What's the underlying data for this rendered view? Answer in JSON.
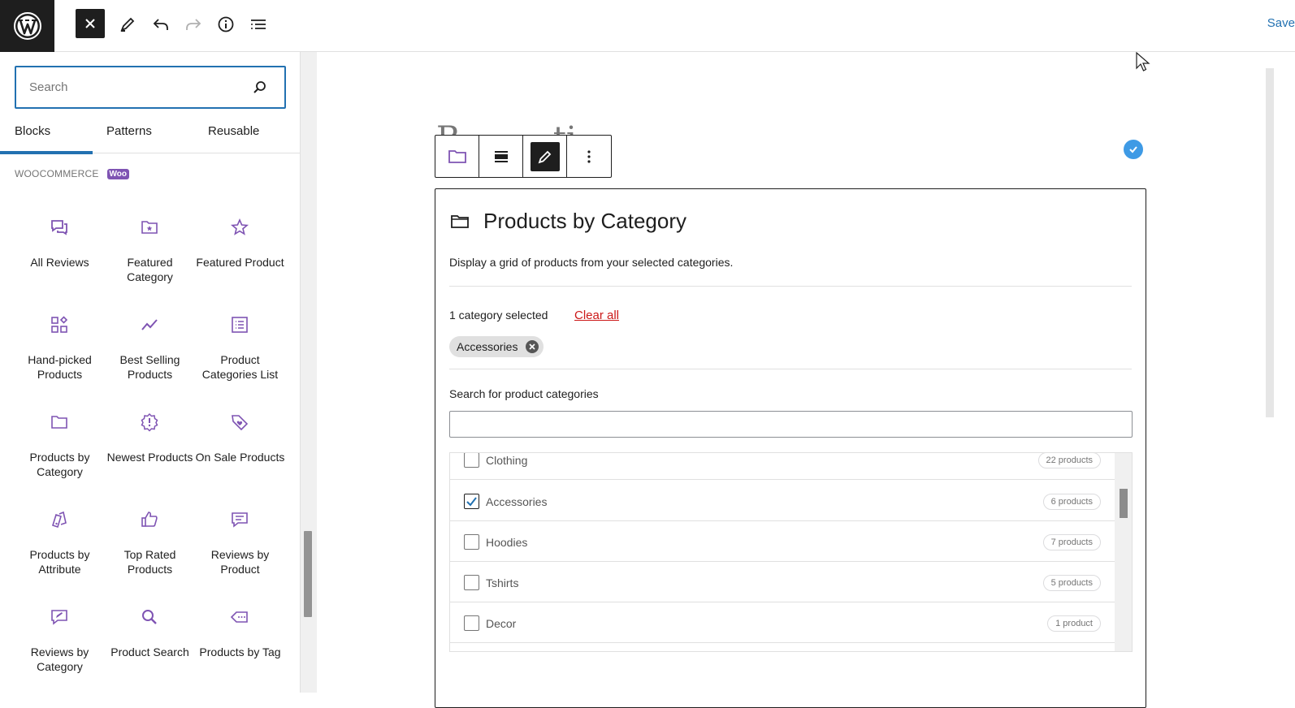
{
  "topbar": {
    "save_label": "Save"
  },
  "sidebar": {
    "search_placeholder": "Search",
    "tabs": [
      {
        "label": "Blocks",
        "active": true
      },
      {
        "label": "Patterns",
        "active": false
      },
      {
        "label": "Reusable",
        "active": false
      }
    ],
    "category_heading": "WOOCOMMERCE",
    "category_badge": "Woo",
    "blocks": [
      {
        "label": "All Reviews",
        "icon": "reviews-icon"
      },
      {
        "label": "Featured Category",
        "icon": "folder-star-icon"
      },
      {
        "label": "Featured Product",
        "icon": "star-icon"
      },
      {
        "label": "Hand-picked Products",
        "icon": "grid-pick-icon"
      },
      {
        "label": "Best Selling Products",
        "icon": "trend-icon"
      },
      {
        "label": "Product Categories List",
        "icon": "list-icon"
      },
      {
        "label": "Products by Category",
        "icon": "folder-icon"
      },
      {
        "label": "Newest Products",
        "icon": "new-badge-icon"
      },
      {
        "label": "On Sale Products",
        "icon": "sale-tag-icon"
      },
      {
        "label": "Products by Attribute",
        "icon": "attribute-icon"
      },
      {
        "label": "Top Rated Products",
        "icon": "thumbs-up-icon"
      },
      {
        "label": "Reviews by Product",
        "icon": "comment-icon"
      },
      {
        "label": "Reviews by Category",
        "icon": "comment-edit-icon"
      },
      {
        "label": "Product Search",
        "icon": "search-icon"
      },
      {
        "label": "Products by Tag",
        "icon": "tag-icon"
      }
    ]
  },
  "canvas": {
    "block": {
      "title": "Products by Category",
      "description": "Display a grid of products from your selected categories.",
      "selected_count": "1 category selected",
      "clear_all": "Clear all",
      "selected_chip": "Accessories",
      "search_label": "Search for product categories",
      "search_value": "",
      "categories": [
        {
          "name": "Clothing",
          "count": "22 products",
          "checked": false
        },
        {
          "name": "Accessories",
          "count": "6 products",
          "checked": true
        },
        {
          "name": "Hoodies",
          "count": "7 products",
          "checked": false
        },
        {
          "name": "Tshirts",
          "count": "5 products",
          "checked": false
        },
        {
          "name": "Decor",
          "count": "1 product",
          "checked": false
        }
      ]
    }
  },
  "colors": {
    "accent": "#2271b1",
    "woo_purple": "#7f54b3",
    "dark": "#1e1e1e",
    "danger": "#cc1818",
    "check_blue": "#3e9ae5"
  }
}
